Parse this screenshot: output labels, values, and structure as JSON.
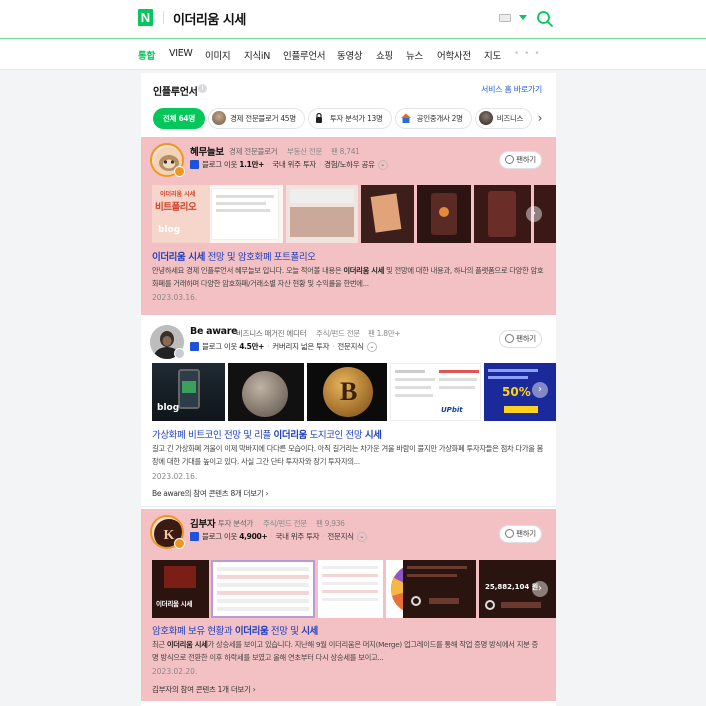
{
  "header": {
    "logo": "N",
    "query": "이더리움 시세"
  },
  "tabs": [
    "통합",
    "VIEW",
    "이미지",
    "지식iN",
    "인플루언서",
    "동영상",
    "쇼핑",
    "뉴스",
    "어학사전",
    "지도"
  ],
  "tabs_more": "• • •",
  "section": {
    "title": "인플루언서",
    "info": "i",
    "service_link": "서비스 홈 바로가기"
  },
  "chips": [
    "전체 64명",
    "경제 전문블로거 45명",
    "투자 분석가 13명",
    "공인중개사 2명",
    "비즈니스"
  ],
  "cards": [
    {
      "name": "혜무늘보",
      "category": "경제 전문블로거",
      "specialty": "부동산 전문",
      "fans": "팬 8,741",
      "blog_prefix": "블로그 이웃",
      "blog_count": "1.1만+",
      "tag1": "국내 위주 투자",
      "tag2": "경험/노하우 공유",
      "fan_button": "팬하기",
      "thumb_text": [
        "이더리움 시세",
        "비트폴리오",
        "blog"
      ],
      "title_pre": "",
      "title_bold": "이더리움 시세",
      "title_post": " 전망 및 암호화폐 포트폴리오",
      "desc_a": "안녕하세요 경제 인플루언서 혜무늘보 입니다. 오늘 적어볼 내용은 ",
      "desc_bold": "이더리움 시세",
      "desc_b": " 및 전망에 대한 내용과, 하나의 플랫폼으로 다양한 암호화폐를 거래하며 다양한 암호화폐/거래소별 자산 현황 및 수익률을 한번에...",
      "date": "2023.03.16."
    },
    {
      "name": "Be aware",
      "category": "비즈니스 매거진 에디터",
      "specialty": "주식/펀드 전문",
      "fans": "팬 1.8만+",
      "blog_prefix": "블로그 이웃",
      "blog_count": "4.5만+",
      "tag1": "커버리지 넓은 투자",
      "tag2": "전문지식",
      "fan_button": "팬하기",
      "thumb_text": [
        "blog",
        "UPbit",
        "50%"
      ],
      "title_pre": "가상화폐 비트코인 전망 및 리플 ",
      "title_bold": "이더리움",
      "title_post": " 도지코인 전망 ",
      "title_bold2": "시세",
      "desc_a": "길고 긴 가상화폐 겨울이 이제 막바지에 다다른 모습이다. 아직 길거리는 차가운 겨울 바람이 불지만 가상화폐 투자자들은 점차 다가올 봄장에 대한 기대를 높이고 있다. 사실 그간 단타 투자자와 장기 투자자의...",
      "date": "2023.02.16.",
      "more_name": "Be aware",
      "more_text": "의 참여 콘텐츠 8개 더보기 ›"
    },
    {
      "name": "김부자",
      "category": "투자 분석가",
      "specialty": "주식/펀드 전문",
      "fans": "팬 9,936",
      "blog_prefix": "블로그 이웃",
      "blog_count": "4,900+",
      "tag1": "국내 위주 투자",
      "tag2": "전문지식",
      "fan_button": "팬하기",
      "thumb_text": [
        "이더리움 시세",
        "25,882,104 원"
      ],
      "title_pre": "암호화폐 보유 현황과 ",
      "title_bold": "이더리움",
      "title_post": " 전망 및 ",
      "title_bold2": "시세",
      "desc_a": "최근 ",
      "desc_bold": "이더리움 시세",
      "desc_b": "가 상승세를 보이고 있습니다. 지난해 9월 이더리움은 머지(Merge) 업그레이드를 통해 작업 증명 방식에서 지분 증명 방식으로 전환한 이후 하락세를 보였고 올해 연초부터 다시 상승세를 보이고...",
      "date": "2023.02.20.",
      "more_name": "김부자",
      "more_text": "의 참여 콘텐츠 1개 더보기 ›"
    }
  ],
  "colors": {
    "brand": "#03c75a",
    "highlight": "#f3c1c3",
    "link": "#1f3fbf"
  }
}
